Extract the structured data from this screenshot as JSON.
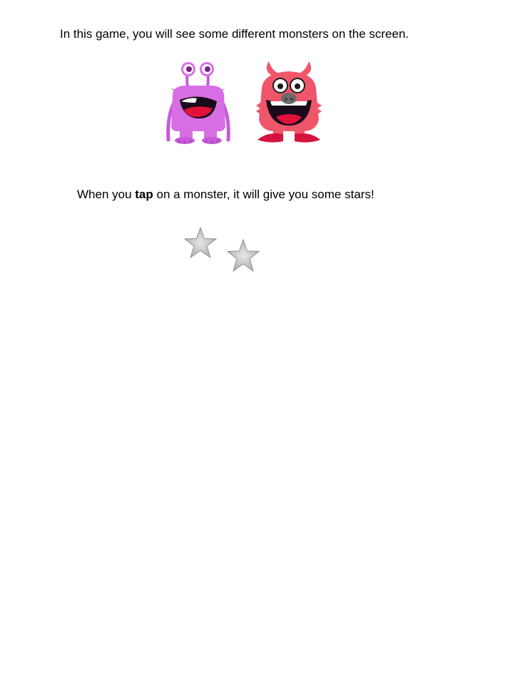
{
  "instructions": {
    "line1": "In this game, you will see some different monsters on the screen.",
    "line2_before": "When you ",
    "line2_bold": "tap",
    "line2_after": " on a monster, it will give you some stars!"
  },
  "illustrations": {
    "monsters": [
      {
        "name": "purple-monster-icon",
        "color": "#d86ee3"
      },
      {
        "name": "red-monster-icon",
        "color": "#f0566a"
      }
    ],
    "stars": [
      {
        "name": "star-icon",
        "color": "#b5b5b5"
      },
      {
        "name": "star-icon",
        "color": "#b5b5b5"
      }
    ]
  }
}
